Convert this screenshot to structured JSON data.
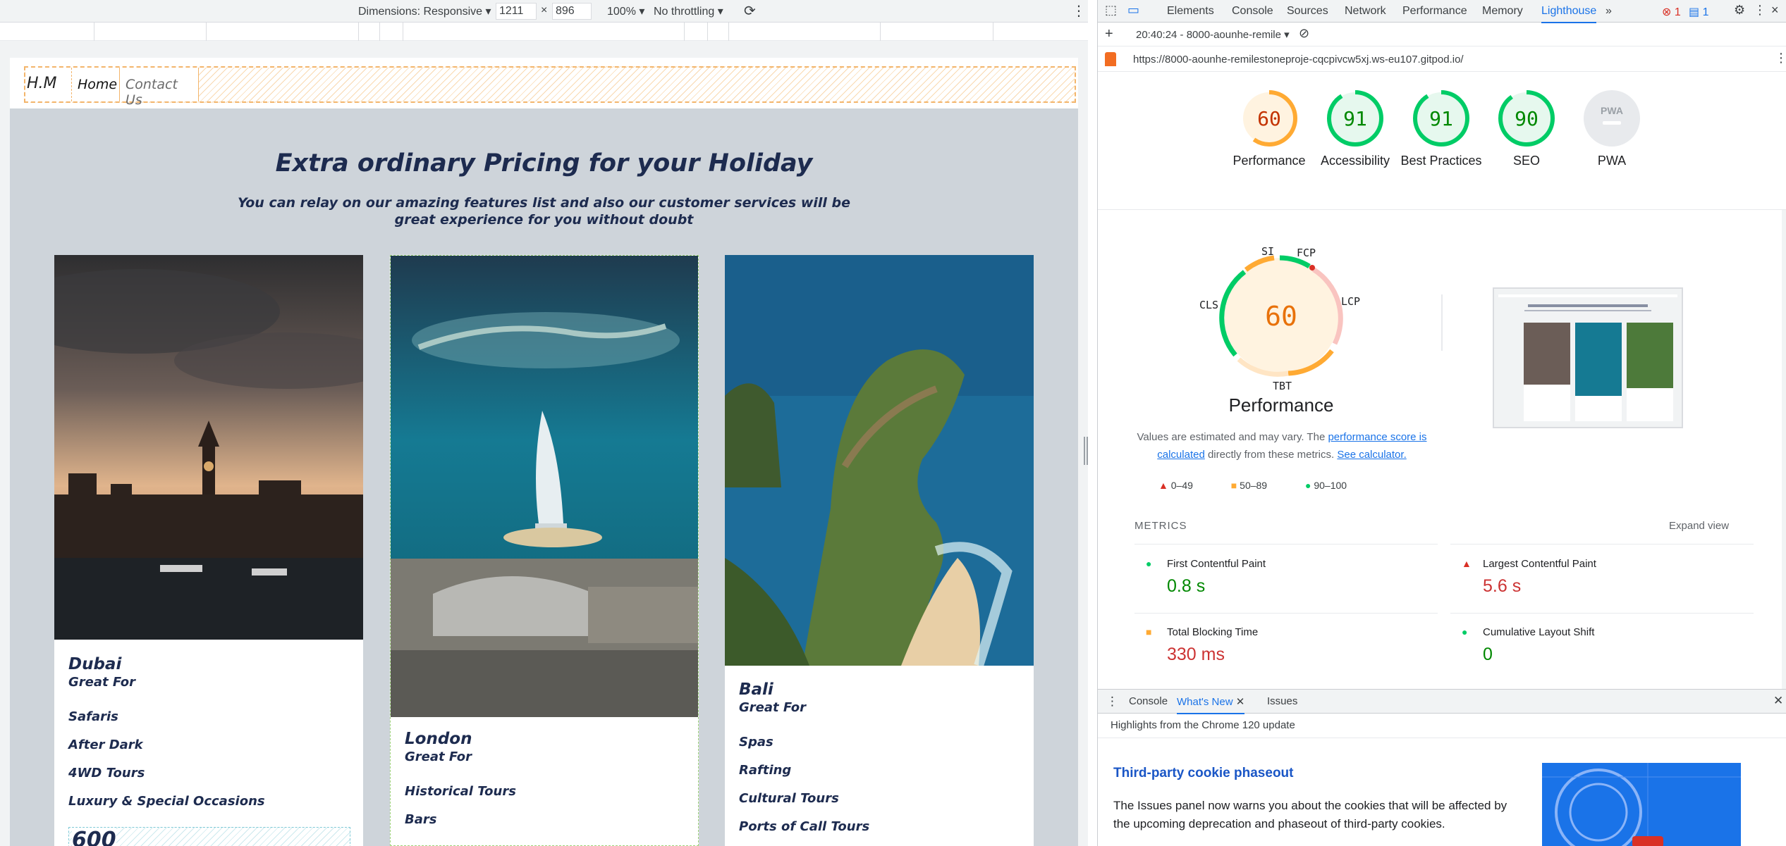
{
  "device_toolbar": {
    "dimensions_label": "Dimensions: Responsive",
    "width_value": "1211",
    "times": "×",
    "height_value": "896",
    "zoom": "100%",
    "throttling": "No throttling"
  },
  "site": {
    "brand": "H.M",
    "nav": [
      "Home",
      "Contact Us"
    ],
    "title": "Extra ordinary Pricing for your Holiday",
    "subtitle": "You can relay on our amazing features list and also our customer services will be great experience for you without doubt",
    "cards": [
      {
        "name": "Dubai",
        "great_for": "Great For",
        "items": [
          "Safaris",
          "After Dark",
          "4WD Tours",
          "Luxury & Special Occasions"
        ],
        "price_partial": "600"
      },
      {
        "name": "London",
        "great_for": "Great For",
        "items": [
          "Historical Tours",
          "Bars"
        ]
      },
      {
        "name": "Bali",
        "great_for": "Great For",
        "items": [
          "Spas",
          "Rafting",
          "Cultural Tours",
          "Ports of Call Tours"
        ]
      }
    ]
  },
  "devtools": {
    "tabs": [
      "Elements",
      "Console",
      "Sources",
      "Network",
      "Performance",
      "Memory",
      "Lighthouse"
    ],
    "more": "»",
    "error_count": "1",
    "message_count": "1",
    "report_time": "20:40:24 - 8000-aounhe-remile",
    "url": "https://8000-aounhe-remilestoneproje-cqcpivcw5xj.ws-eu107.gitpod.io/",
    "scores": [
      {
        "value": "60",
        "label": "Performance",
        "color": "#fa3"
      },
      {
        "value": "91",
        "label": "Accessibility",
        "color": "#0c6"
      },
      {
        "value": "91",
        "label": "Best Practices",
        "color": "#0c6"
      },
      {
        "value": "90",
        "label": "SEO",
        "color": "#0c6"
      },
      {
        "value": "PWA",
        "label": "PWA",
        "color": "#9aa0a6"
      }
    ],
    "gauge_labels": {
      "si": "SI",
      "fcp": "FCP",
      "lcp": "LCP",
      "tbt": "TBT",
      "cls": "CLS"
    },
    "big_score": "60",
    "big_label": "Performance",
    "note_pre": "Values are estimated and may vary. The ",
    "note_link1": "performance score is calculated",
    "note_mid": " directly from these metrics. ",
    "note_link2": "See calculator.",
    "legend": [
      "0–49",
      "50–89",
      "90–100"
    ],
    "metrics_header": "METRICS",
    "expand_view": "Expand view",
    "metrics": [
      {
        "title": "First Contentful Paint",
        "value": "0.8 s",
        "color": "#080"
      },
      {
        "title": "Largest Contentful Paint",
        "value": "5.6 s",
        "color": "#c33"
      },
      {
        "title": "Total Blocking Time",
        "value": "330 ms",
        "color": "#c33"
      },
      {
        "title": "Cumulative Layout Shift",
        "value": "0",
        "color": "#080"
      }
    ],
    "drawer_tabs": [
      "Console",
      "What's New",
      "Issues"
    ],
    "drawer_highlight": "Highlights from the Chrome 120 update",
    "drawer_heading": "Third-party cookie phaseout",
    "drawer_text": "The Issues panel now warns you about the cookies that will be affected by the upcoming deprecation and phaseout of third-party cookies."
  }
}
